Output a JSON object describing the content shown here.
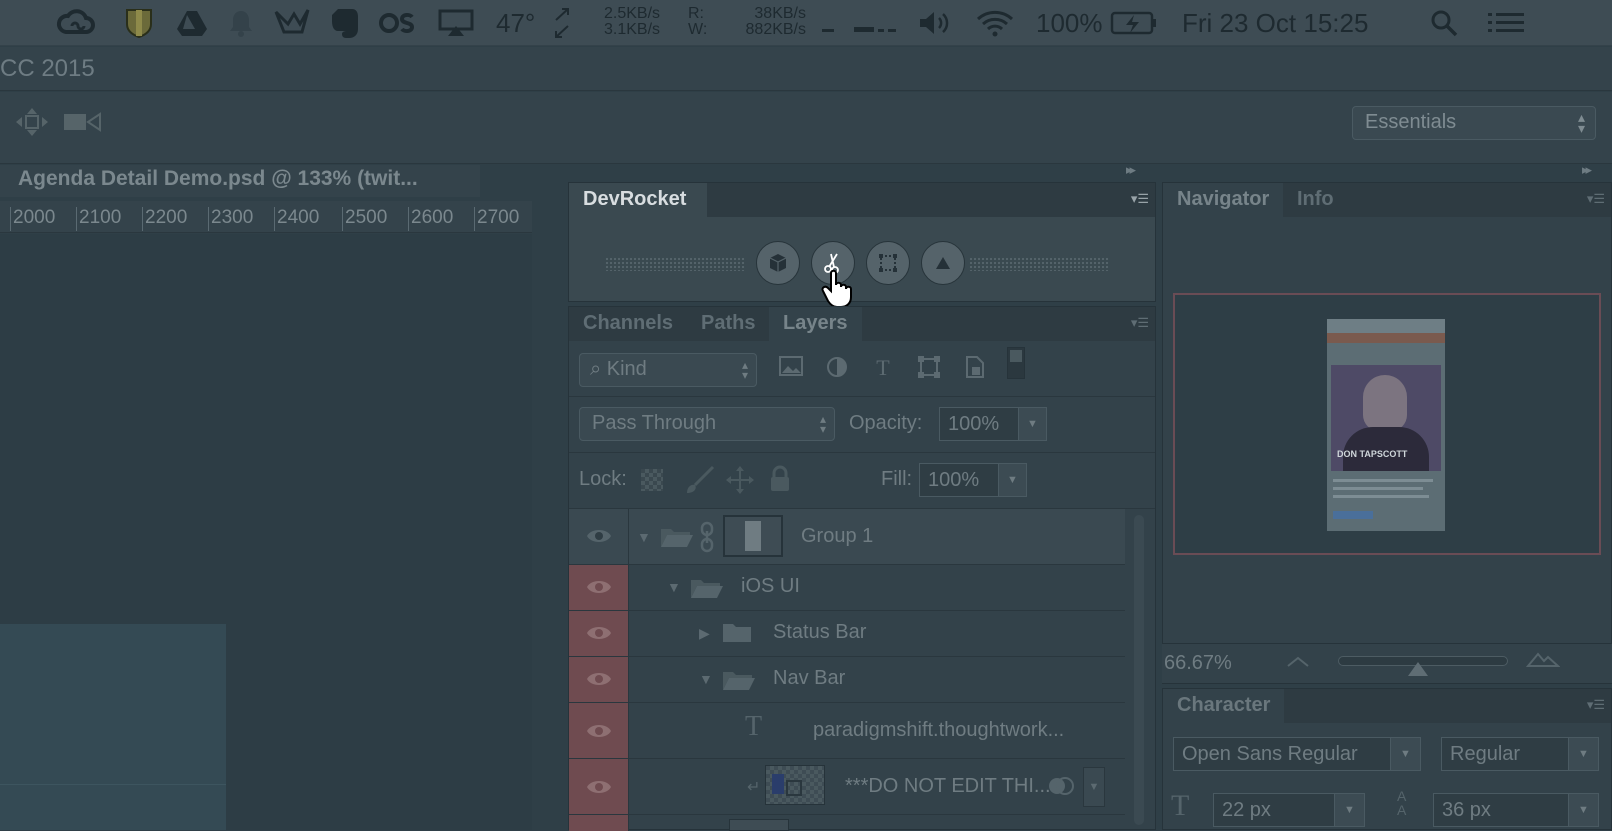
{
  "menubar": {
    "temperature": "47°",
    "net_down": "2.5KB/s",
    "net_up": "3.1KB/s",
    "disk_read_label": "R:",
    "disk_write_label": "W:",
    "disk_read": "38KB/s",
    "disk_write": "882KB/s",
    "battery": "100%",
    "datetime": "Fri 23 Oct  15:25",
    "icons": [
      "creative-cloud-icon",
      "shield-icon",
      "google-drive-icon",
      "bell-icon",
      "crane-icon",
      "evernote-icon",
      "os-icon",
      "airplay-icon",
      "arrows-icon",
      "volume-icon",
      "wifi-icon",
      "battery-icon",
      "spotlight-icon",
      "menu-list-icon"
    ]
  },
  "app": {
    "title_fragment": "CC 2015",
    "workspace": "Essentials",
    "document_tab": "Agenda Detail Demo.psd @ 133% (twit...",
    "ruler_ticks": [
      "2000",
      "2100",
      "2200",
      "2300",
      "2400",
      "2500",
      "2600",
      "2700"
    ]
  },
  "devrocket": {
    "title": "DevRocket",
    "buttons": [
      "cube-icon",
      "scissors-icon",
      "artboard-icon",
      "triangle-icon"
    ]
  },
  "layers_panel": {
    "tabs": [
      "Channels",
      "Paths",
      "Layers"
    ],
    "active_tab": "Layers",
    "filter_kind": "Kind",
    "blend_mode": "Pass Through",
    "opacity_label": "Opacity:",
    "opacity": "100%",
    "lock_label": "Lock:",
    "fill_label": "Fill:",
    "fill": "100%",
    "layers": [
      {
        "name": "Group 1"
      },
      {
        "name": "iOS UI"
      },
      {
        "name": "Status Bar"
      },
      {
        "name": "Nav Bar"
      },
      {
        "name": "paradigmshift.thoughtwork..."
      },
      {
        "name": "***DO NOT EDIT THI..."
      }
    ]
  },
  "navigator": {
    "tabs": [
      "Navigator",
      "Info"
    ],
    "active_tab": "Navigator",
    "zoom": "66.67%",
    "preview_caption": "DON TAPSCOTT"
  },
  "character": {
    "title": "Character",
    "font_family": "Open Sans Regular",
    "font_style": "Regular",
    "font_size": "22 px",
    "leading": "36 px"
  },
  "colors": {
    "muted_red": "#a85a5f",
    "panel": "#33424a"
  }
}
